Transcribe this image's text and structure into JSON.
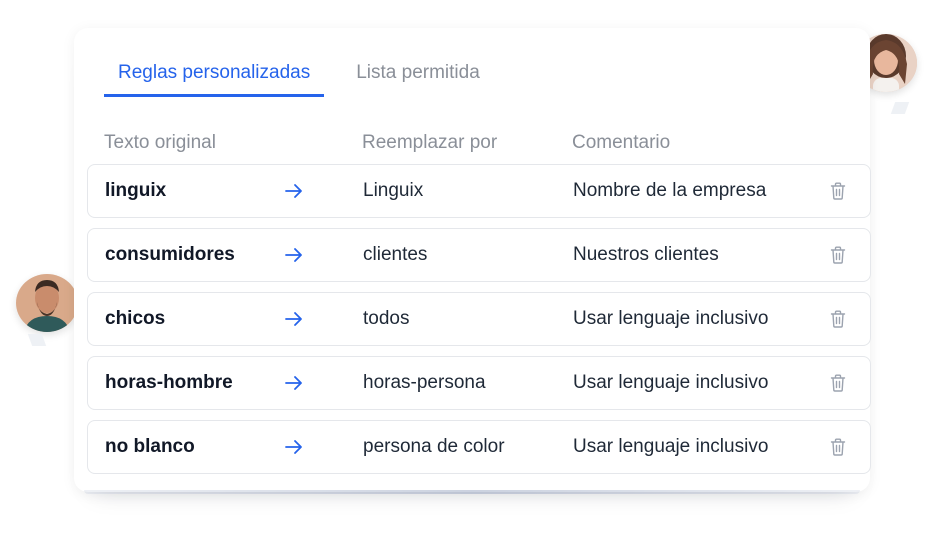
{
  "colors": {
    "accent": "#2563eb",
    "inactive_tab": "#8a8f98",
    "icon_gray": "#9ca3af"
  },
  "tabs": [
    {
      "label": "Reglas personalizadas",
      "active": true,
      "color": "#2563eb"
    },
    {
      "label": "Lista permitida",
      "active": false,
      "color": "#8a8f98"
    }
  ],
  "table": {
    "headers": {
      "original": "Texto original",
      "replace": "Reemplazar por",
      "comment": "Comentario"
    },
    "rows": [
      {
        "original": "linguix",
        "replace": "Linguix",
        "comment": "Nombre de la empresa"
      },
      {
        "original": "consumidores",
        "replace": "clientes",
        "comment": "Nuestros clientes"
      },
      {
        "original": "chicos",
        "replace": "todos",
        "comment": "Usar lenguaje inclusivo"
      },
      {
        "original": "horas-hombre",
        "replace": "horas-persona",
        "comment": "Usar lenguaje inclusivo"
      },
      {
        "original": "no blanco",
        "replace": "persona de color",
        "comment": "Usar lenguaje inclusivo"
      }
    ]
  },
  "icons": {
    "arrow": "arrow-right-icon",
    "delete": "trash-icon",
    "avatar_left": "avatar-man-photo",
    "avatar_right": "avatar-woman-photo"
  }
}
